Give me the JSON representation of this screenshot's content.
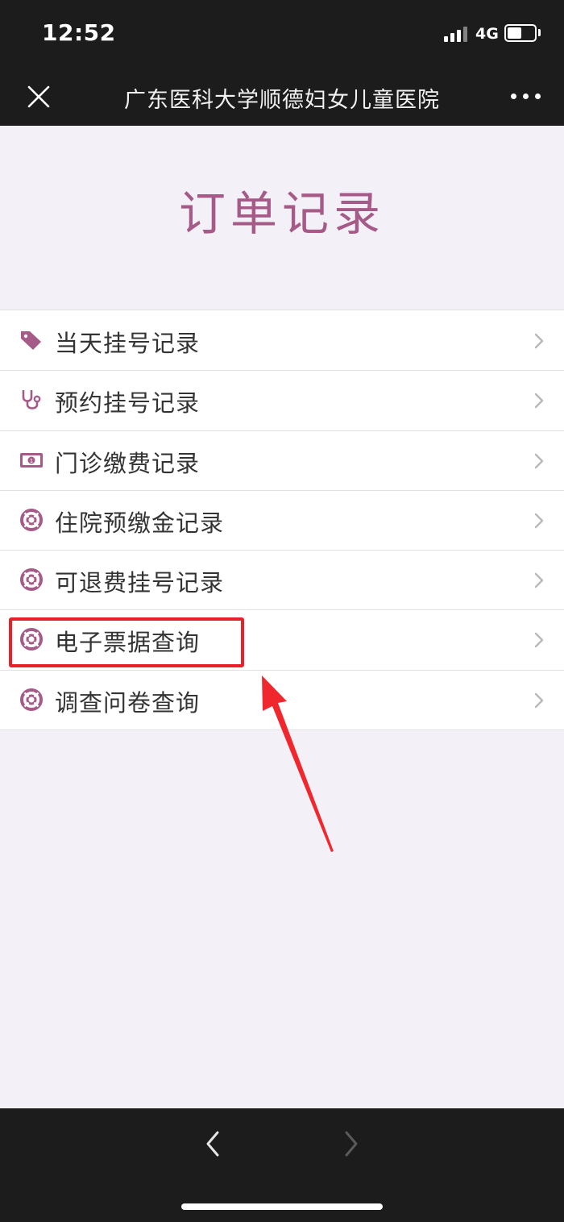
{
  "status_bar": {
    "time": "12:52",
    "network": "4G"
  },
  "nav": {
    "title": "广东医科大学顺德妇女儿童医院",
    "close_icon": "close-icon",
    "more_icon": "more-icon"
  },
  "page": {
    "title": "订单记录"
  },
  "menu": {
    "items": [
      {
        "label": "当天挂号记录",
        "icon": "tag-icon"
      },
      {
        "label": "预约挂号记录",
        "icon": "stethoscope-icon"
      },
      {
        "label": "门诊缴费记录",
        "icon": "money-icon"
      },
      {
        "label": "住院预缴金记录",
        "icon": "lifebuoy-icon"
      },
      {
        "label": "可退费挂号记录",
        "icon": "lifebuoy-icon"
      },
      {
        "label": "电子票据查询",
        "icon": "lifebuoy-icon"
      },
      {
        "label": "调查问卷查询",
        "icon": "lifebuoy-icon"
      }
    ]
  },
  "colors": {
    "accent": "#a65a87",
    "annotation": "#e8202a",
    "bar_bg": "#1c1c1c",
    "page_bg": "#f3f0f7"
  }
}
